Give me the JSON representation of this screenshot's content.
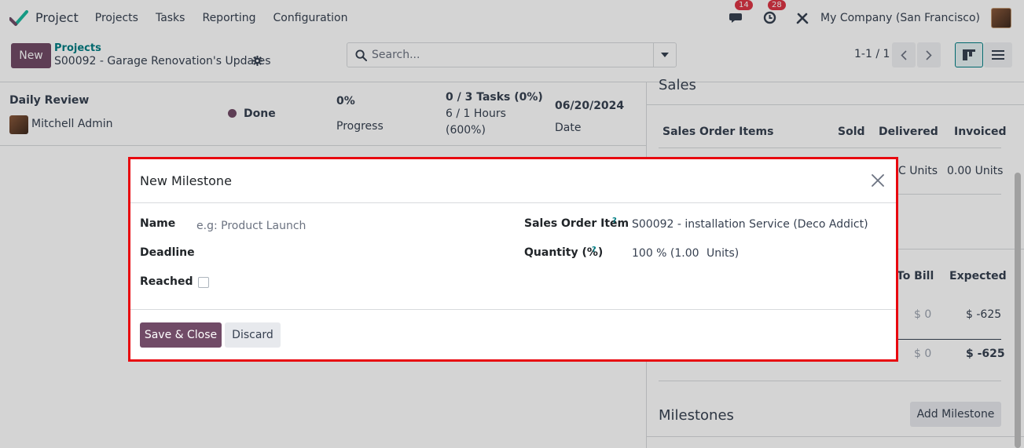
{
  "navbar": {
    "app_name": "Project",
    "menu": [
      "Projects",
      "Tasks",
      "Reporting",
      "Configuration"
    ],
    "messages_count": "14",
    "activities_count": "28",
    "company": "My Company (San Francisco)"
  },
  "control_panel": {
    "new_label": "New",
    "breadcrumb_parent": "Projects",
    "breadcrumb_current": "S00092 - Garage Renovation's Updates",
    "search_placeholder": "Search...",
    "pager": "1-1 / 1"
  },
  "update": {
    "title": "Daily Review",
    "author": "Mitchell Admin",
    "status": "Done",
    "progress_value": "0%",
    "progress_label": "Progress",
    "tasks": "0 / 3 Tasks (0%)",
    "hours_line1": "6 / 1 Hours",
    "hours_line2": "(600%)",
    "date_value": "06/20/2024",
    "date_label": "Date"
  },
  "sidebar": {
    "sales_title": "Sales",
    "sales_headers": [
      "Sales Order Items",
      "Sold",
      "Delivered",
      "Invoiced"
    ],
    "sales_row": {
      "delivered": "C Units",
      "invoiced": "0.00 Units"
    },
    "profit_headers": {
      "to_bill": "To Bill",
      "expected": "Expected"
    },
    "profit_row1": {
      "to_bill": "$ 0",
      "expected": "$ -625"
    },
    "profit_row2": {
      "to_bill": "$ 0",
      "expected": "$ -625"
    },
    "milestones_title": "Milestones",
    "add_milestone": "Add Milestone"
  },
  "modal": {
    "title": "New Milestone",
    "name_label": "Name",
    "name_placeholder": "e.g: Product Launch",
    "deadline_label": "Deadline",
    "reached_label": "Reached",
    "sol_label": "Sales Order Item",
    "sol_value": "S00092 - installation Service (Deco Addict)",
    "qty_label": "Quantity (%)",
    "qty_value": "100 % (1.00",
    "qty_unit": "Units)",
    "help_mark": "?",
    "save_label": "Save & Close",
    "discard_label": "Discard"
  },
  "colors": {
    "brand": "#714b67",
    "accent": "#017e84",
    "highlight": "#e8080f"
  }
}
